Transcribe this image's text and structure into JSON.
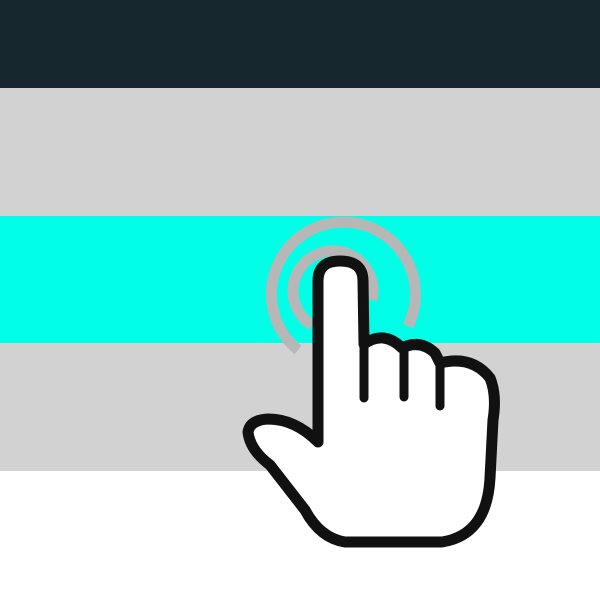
{
  "colors": {
    "header": "#16282d",
    "row_default": "#d2d2d2",
    "row_highlight": "#00ffe6",
    "background": "#ffffff",
    "ripple": "#b7b7b7",
    "hand_fill": "#ffffff",
    "hand_outline": "#111111"
  },
  "rows": [
    {
      "state": "default"
    },
    {
      "state": "highlighted"
    },
    {
      "state": "default"
    }
  ],
  "icons": {
    "pointer": "hand-tap-icon",
    "ripple": "tap-ripple-icon"
  }
}
